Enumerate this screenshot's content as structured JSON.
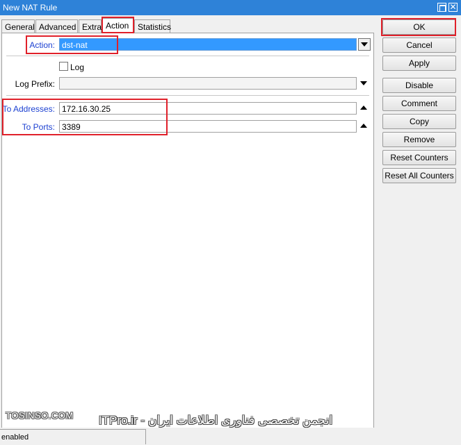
{
  "window": {
    "title": "New NAT Rule",
    "restore_glyph": "",
    "close_glyph": "✕"
  },
  "tabs": [
    {
      "label": "General",
      "active": false
    },
    {
      "label": "Advanced",
      "active": false
    },
    {
      "label": "Extra",
      "active": false
    },
    {
      "label": "Action",
      "active": true
    },
    {
      "label": "Statistics",
      "active": false
    }
  ],
  "form": {
    "action": {
      "label": "Action:",
      "value": "dst-nat"
    },
    "log": {
      "label": "Log",
      "checked": false
    },
    "log_prefix": {
      "label": "Log Prefix:",
      "value": ""
    },
    "to_addresses": {
      "label": "To Addresses:",
      "value": "172.16.30.25"
    },
    "to_ports": {
      "label": "To Ports:",
      "value": "3389"
    }
  },
  "buttons": {
    "ok": "OK",
    "cancel": "Cancel",
    "apply": "Apply",
    "disable": "Disable",
    "comment": "Comment",
    "copy": "Copy",
    "remove": "Remove",
    "reset_counters": "Reset Counters",
    "reset_all_counters": "Reset All Counters"
  },
  "status": {
    "text": "enabled"
  },
  "watermark": {
    "site": "TOSINSO.COM",
    "brand": "ITPro.ir - انجمن تخصصی فناوری اطلاعات ایران"
  },
  "colors": {
    "title_bar": "#2e82d8",
    "selection": "#3399ff",
    "highlight_box": "#e0202a",
    "field_label": "#1a3fd1"
  }
}
